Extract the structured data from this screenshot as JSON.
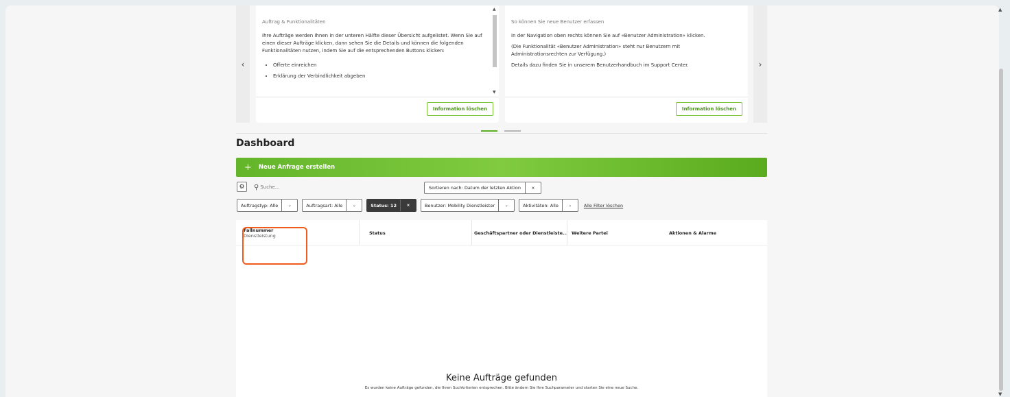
{
  "carousel": {
    "prev_icon": "chevron-left-icon",
    "next_icon": "chevron-right-icon",
    "cards": [
      {
        "title": "Auftrag & Funktionalitäten",
        "paragraphs": [
          "Ihre Aufträge werden Ihnen in der unteren Hälfte dieser Übersicht aufgelistet. Wenn Sie auf einen dieser Aufträge klicken, dann sehen Sie die Details und können die folgenden Funktionalitäten nutzen, indem Sie auf die entsprechenden Buttons klicken:"
        ],
        "bullets": [
          "Offerte einreichen",
          "Erklärung der Verbindlichkeit abgeben"
        ],
        "button": "Information löschen"
      },
      {
        "title": "So können Sie neue Benutzer erfassen",
        "paragraphs": [
          "In der Navigation oben rechts können Sie auf «Benutzer Administration» klicken.",
          "(Die Funktionalität «Benutzer Administration» steht nur Benutzern mit Administrationsrechten zur Verfügung.)",
          "Details dazu finden Sie in unserem Benutzerhandbuch im Support Center."
        ],
        "button": "Information löschen"
      }
    ]
  },
  "dashboard": {
    "title": "Dashboard",
    "new_request": "Neue Anfrage erstellen",
    "search_placeholder": "Suche...",
    "sort_label": "Sortieren nach: Datum der letzten Aktion",
    "filters": [
      {
        "label": "Auftragstyp: Alle",
        "kind": "dropdown"
      },
      {
        "label": "Auftragsart: Alle",
        "kind": "dropdown"
      },
      {
        "label": "Status: 12",
        "kind": "remove"
      },
      {
        "label": "Benutzer: Mobility Dienstleister",
        "kind": "dropdown"
      },
      {
        "label": "Aktivitäten: Alle",
        "kind": "dropdown"
      }
    ],
    "clear_filters": "Alle Filter löschen"
  },
  "table": {
    "columns": [
      {
        "label": "Fallnummer",
        "sub": "Dienstleistung"
      },
      {
        "label": "Status"
      },
      {
        "label": "Geschäftspartner oder Dienstleiste..."
      },
      {
        "label": "Weitere Partei"
      },
      {
        "label": "Aktionen & Alarme"
      }
    ],
    "empty_title": "Keine Aufträge gefunden",
    "empty_message": "Es wurden keine Aufträge gefunden, die Ihren Suchkriterien entsprechen. Bitte ändern Sie Ihre Suchparameter und starten Sie eine neue Suche."
  },
  "colors": {
    "accent": "#7cc23c",
    "highlight": "#f05a1a"
  }
}
